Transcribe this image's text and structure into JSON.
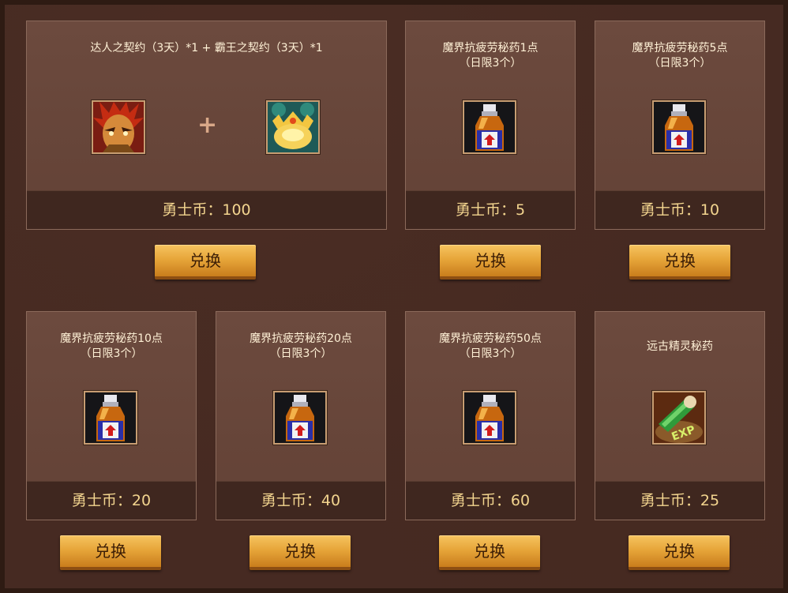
{
  "exchange_label": "兑换",
  "items": [
    {
      "title": "达人之契约（3天）*1 + 霸王之契约（3天）*1",
      "icons": [
        "warrior-portrait-icon",
        "golden-crown-icon"
      ],
      "price": "勇士币：100"
    },
    {
      "title": "魔界抗疲劳秘药1点\n（日限3个）",
      "icons": [
        "potion-bottle-icon"
      ],
      "price": "勇士币：5"
    },
    {
      "title": "魔界抗疲劳秘药5点\n（日限3个）",
      "icons": [
        "potion-bottle-icon"
      ],
      "price": "勇士币：10"
    },
    {
      "title": "魔界抗疲劳秘药10点\n（日限3个）",
      "icons": [
        "potion-bottle-icon"
      ],
      "price": "勇士币：20"
    },
    {
      "title": "魔界抗疲劳秘药20点\n（日限3个）",
      "icons": [
        "potion-bottle-icon"
      ],
      "price": "勇士币：40"
    },
    {
      "title": "魔界抗疲劳秘药50点\n（日限3个）",
      "icons": [
        "potion-bottle-icon"
      ],
      "price": "勇士币：60"
    },
    {
      "title": "远古精灵秘药",
      "icons": [
        "exp-scroll-icon"
      ],
      "price": "勇士币：25"
    }
  ]
}
